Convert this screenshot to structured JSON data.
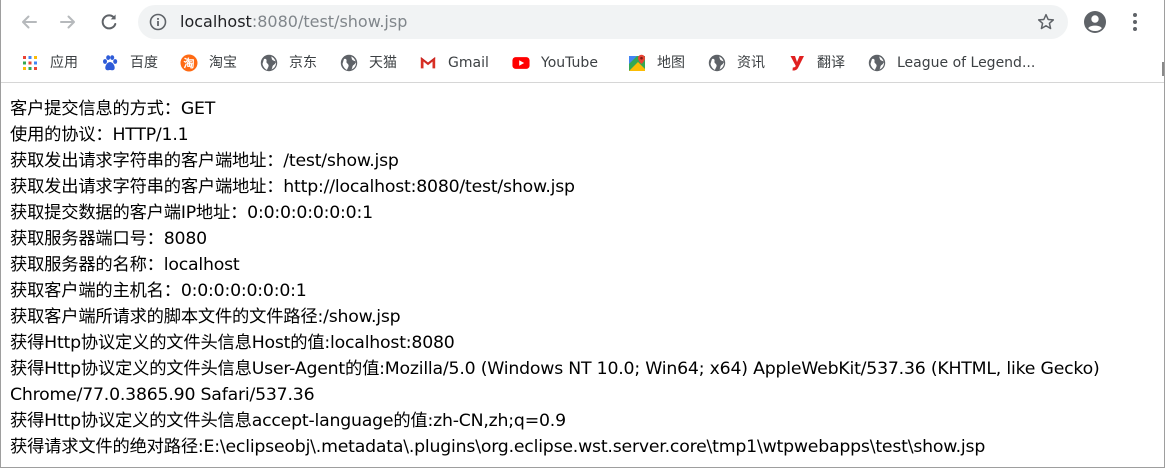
{
  "browser": {
    "url_host": "localhost",
    "url_rest": ":8080/test/show.jsp",
    "icons": {
      "back": "back-arrow-icon",
      "forward": "forward-arrow-icon",
      "reload": "reload-icon",
      "site_info": "info-icon",
      "bookmark_star": "star-icon",
      "profile": "account-icon",
      "menu": "kebab-menu-icon"
    }
  },
  "bookmarks": [
    {
      "label": "应用",
      "icon": "apps-grid-icon"
    },
    {
      "label": "百度",
      "icon": "baidu-paw-icon"
    },
    {
      "label": "淘宝",
      "icon": "taobao-icon"
    },
    {
      "label": "京东",
      "icon": "globe-icon"
    },
    {
      "label": "天猫",
      "icon": "globe-icon"
    },
    {
      "label": "Gmail",
      "icon": "gmail-icon"
    },
    {
      "label": "YouTube",
      "icon": "youtube-icon"
    },
    {
      "label": "地图",
      "icon": "maps-icon"
    },
    {
      "label": "资讯",
      "icon": "globe-icon"
    },
    {
      "label": "翻译",
      "icon": "translate-y-icon"
    },
    {
      "label": "League of Legend...",
      "icon": "globe-icon"
    }
  ],
  "page": {
    "lines": [
      "客户提交信息的方式：GET",
      "使用的协议：HTTP/1.1",
      "获取发出请求字符串的客户端地址：/test/show.jsp",
      "获取发出请求字符串的客户端地址：http://localhost:8080/test/show.jsp",
      "获取提交数据的客户端IP地址：0:0:0:0:0:0:0:1",
      "获取服务器端口号：8080",
      "获取服务器的名称：localhost",
      "获取客户端的主机名：0:0:0:0:0:0:0:1",
      "获取客户端所请求的脚本文件的文件路径:/show.jsp",
      "获得Http协议定义的文件头信息Host的值:localhost:8080",
      "获得Http协议定义的文件头信息User-Agent的值:Mozilla/5.0 (Windows NT 10.0; Win64; x64) AppleWebKit/537.36 (KHTML, like Gecko) Chrome/77.0.3865.90 Safari/537.36",
      "获得Http协议定义的文件头信息accept-language的值:zh-CN,zh;q=0.9",
      "获得请求文件的绝对路径:E:\\eclipseobj\\.metadata\\.plugins\\org.eclipse.wst.server.core\\tmp1\\wtpwebapps\\test\\show.jsp"
    ]
  }
}
